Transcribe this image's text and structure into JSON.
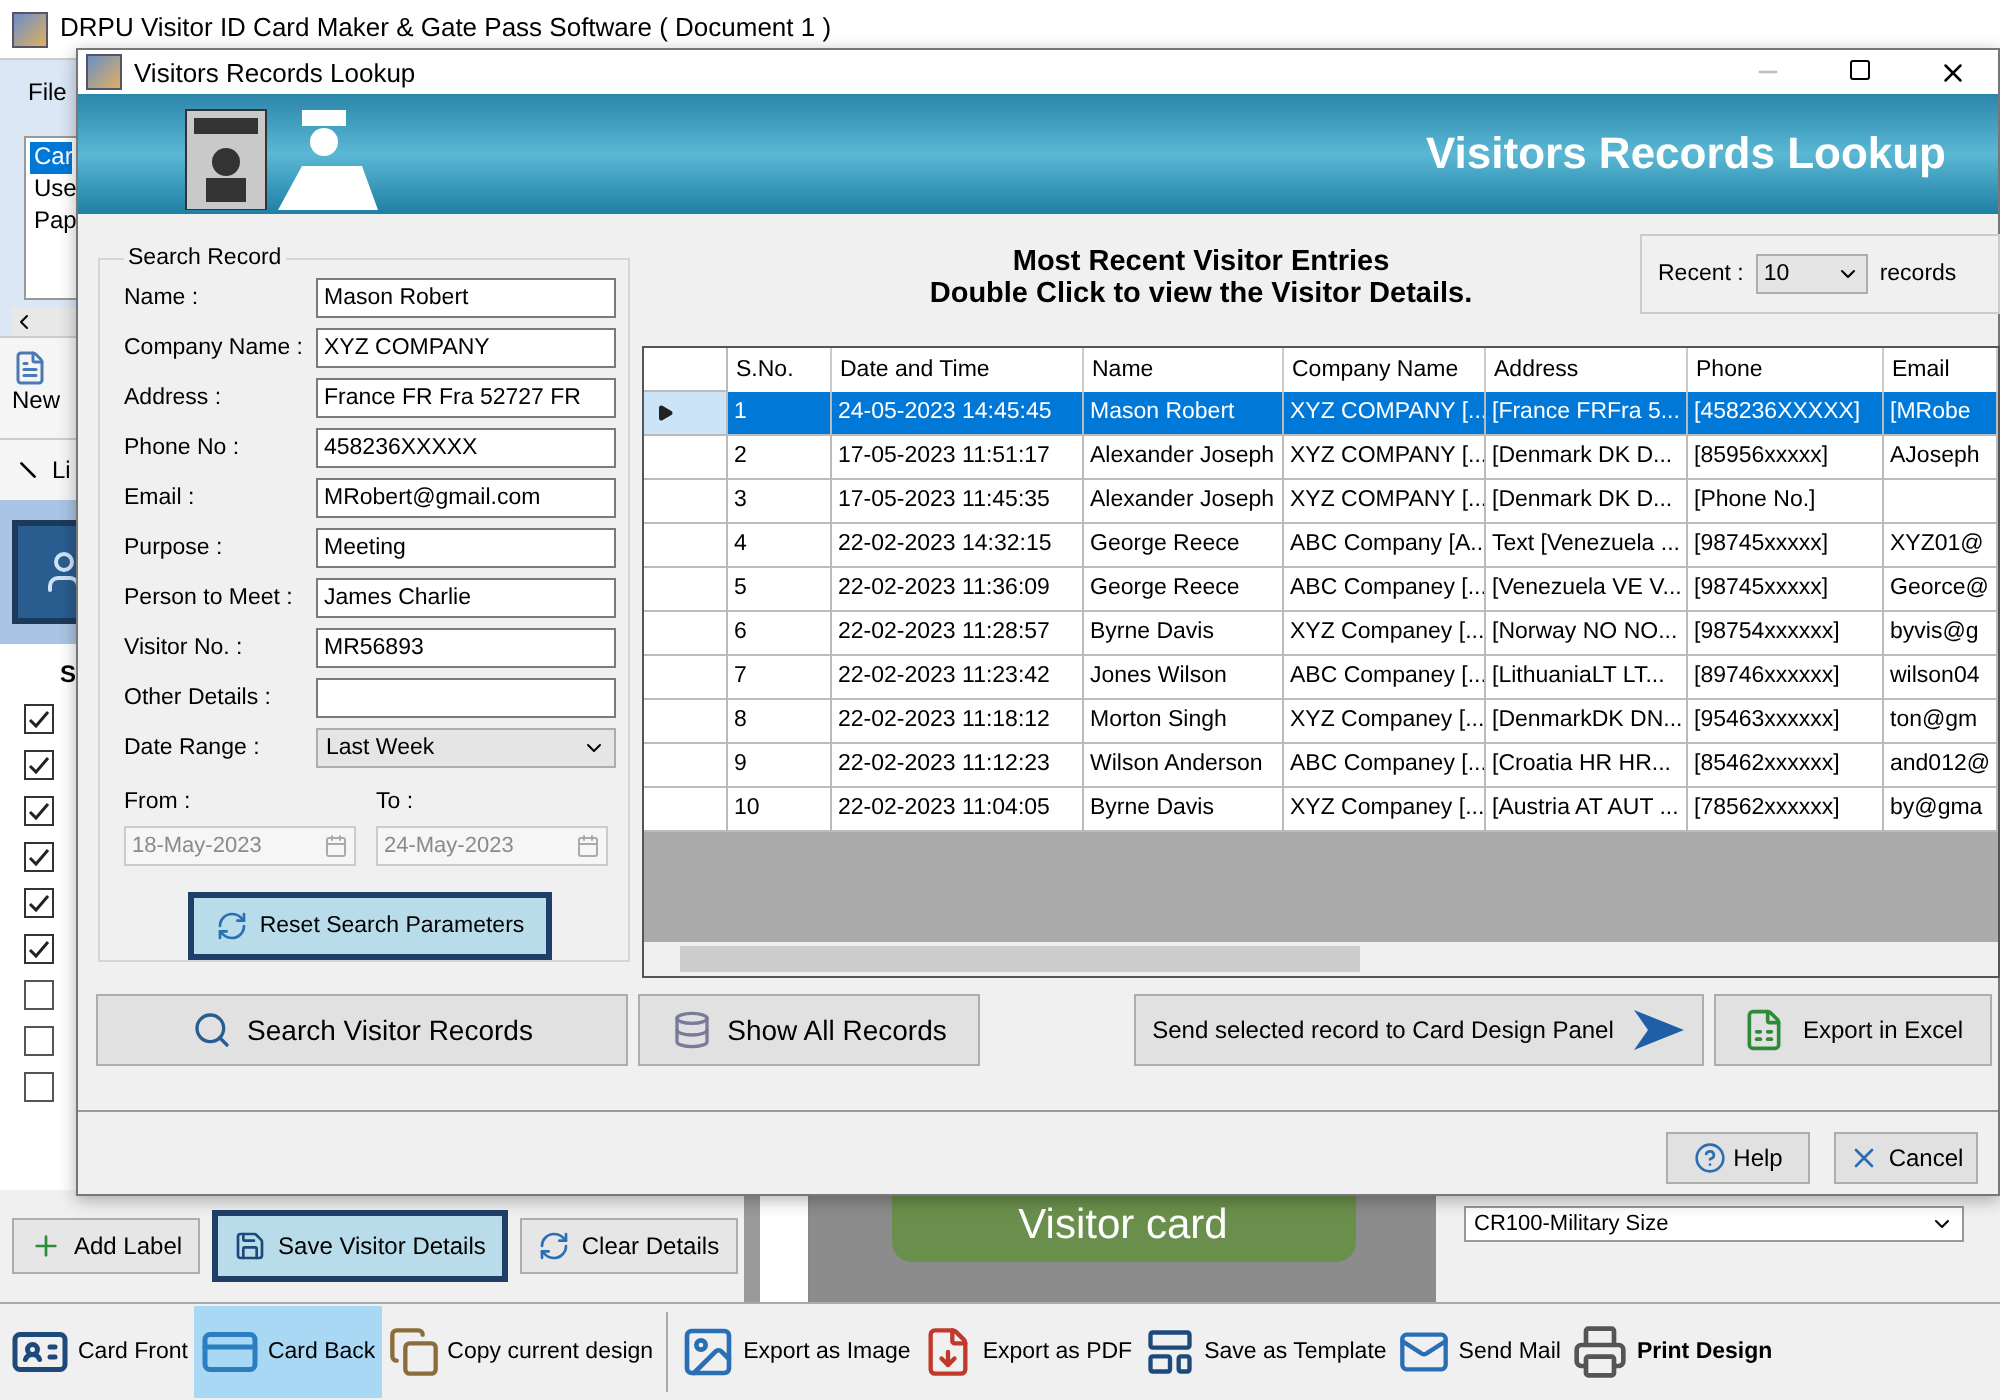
{
  "app": {
    "title": "DRPU Visitor ID Card Maker & Gate Pass Software ( Document 1 )",
    "menu": [
      "File"
    ],
    "list_items": [
      {
        "label": "Car",
        "selected": true
      },
      {
        "label": "Use",
        "selected": false
      },
      {
        "label": "Pap",
        "selected": false
      }
    ],
    "tools": [
      "New",
      "Li"
    ],
    "section_heading": "S",
    "checkboxes": [
      {
        "checked": true
      },
      {
        "checked": true
      },
      {
        "checked": true
      },
      {
        "checked": true
      },
      {
        "checked": true
      },
      {
        "checked": true
      },
      {
        "checked": false
      },
      {
        "checked": false
      },
      {
        "checked": false
      }
    ],
    "bottom_buttons": [
      {
        "label": "Add Label",
        "highlighted": false
      },
      {
        "label": "Save Visitor Details",
        "highlighted": true
      },
      {
        "label": "Clear Details",
        "highlighted": false
      }
    ],
    "canvas_text": "Visitor card",
    "size_select": "CR100-Military Size",
    "toolbar": [
      {
        "kind": "front",
        "label": "Card Front",
        "selected": false,
        "bold": false
      },
      {
        "kind": "back",
        "label": "Card Back",
        "selected": true,
        "bold": false
      },
      {
        "kind": "copy",
        "label": "Copy current design",
        "selected": false,
        "bold": false
      },
      {
        "kind": "image",
        "label": "Export as Image",
        "selected": false,
        "bold": false
      },
      {
        "kind": "pdf",
        "label": "Export as PDF",
        "selected": false,
        "bold": false
      },
      {
        "kind": "template",
        "label": "Save as Template",
        "selected": false,
        "bold": false
      },
      {
        "kind": "mail",
        "label": "Send Mail",
        "selected": false,
        "bold": false
      },
      {
        "kind": "print",
        "label": "Print Design",
        "selected": false,
        "bold": true
      }
    ]
  },
  "dialog": {
    "title": "Visitors Records Lookup",
    "banner_title": "Visitors Records Lookup",
    "search_record": {
      "legend": "Search Record",
      "fields": [
        {
          "label": "Name :",
          "value": "Mason Robert"
        },
        {
          "label": "Company Name :",
          "value": "XYZ COMPANY"
        },
        {
          "label": "Address :",
          "value": "France FR Fra 52727 FR"
        },
        {
          "label": "Phone No :",
          "value": "458236XXXXX"
        },
        {
          "label": "Email :",
          "value": "MRobert@gmail.com"
        },
        {
          "label": "Purpose :",
          "value": "Meeting"
        },
        {
          "label": "Person to Meet :",
          "value": "James Charlie"
        },
        {
          "label": "Visitor No. :",
          "value": "MR56893"
        },
        {
          "label": "Other Details :"
        }
      ],
      "date_range": {
        "label": "Date Range :",
        "value": "Last Week"
      },
      "from": {
        "label": "From :",
        "value": "18-May-2023",
        "disabled": true
      },
      "to": {
        "label": "To :",
        "value": "24-May-2023",
        "disabled": true
      },
      "reset_button": "Reset Search Parameters"
    },
    "heading": [
      "Most Recent Visitor Entries",
      "Double Click to view the Visitor Details."
    ],
    "recent": {
      "label": "Recent :",
      "value": "10",
      "unit": "records"
    },
    "table": {
      "columns": [
        "S.No.",
        "Date and Time",
        "Name",
        "Company Name",
        "Address",
        "Phone",
        "Email"
      ],
      "rows": [
        {
          "selected": true,
          "cells": [
            "1",
            "24-05-2023 14:45:45",
            "Mason Robert",
            "XYZ COMPANY [...",
            "[France FRFra 5...",
            "[458236XXXXX]",
            "[MRobe"
          ]
        },
        {
          "selected": false,
          "cells": [
            "2",
            "17-05-2023 11:51:17",
            "Alexander Joseph",
            "XYZ COMPANY [...",
            "[Denmark DK D...",
            "[85956xxxxx]",
            "AJoseph"
          ]
        },
        {
          "selected": false,
          "cells": [
            "3",
            "17-05-2023 11:45:35",
            "Alexander Joseph",
            "XYZ COMPANY [...",
            "[Denmark DK D...",
            "[Phone No.]"
          ]
        },
        {
          "selected": false,
          "cells": [
            "4",
            "22-02-2023 14:32:15",
            "George Reece",
            "ABC Company [A...",
            "Text [Venezuela ...",
            "[98745xxxxx]",
            "XYZ01@"
          ]
        },
        {
          "selected": false,
          "cells": [
            "5",
            "22-02-2023 11:36:09",
            "George Reece",
            "ABC Companey [...",
            "[Venezuela VE V...",
            "[98745xxxxx]",
            "Georce@"
          ]
        },
        {
          "selected": false,
          "cells": [
            "6",
            "22-02-2023 11:28:57",
            "Byrne Davis",
            "XYZ Companey [...",
            "[Norway NO NO...",
            "[98754xxxxxx]",
            "byvis@g"
          ]
        },
        {
          "selected": false,
          "cells": [
            "7",
            "22-02-2023 11:23:42",
            "Jones Wilson",
            "ABC Companey [...",
            "[LithuaniaLT LT...",
            "[89746xxxxxx]",
            "wilson04"
          ]
        },
        {
          "selected": false,
          "cells": [
            "8",
            "22-02-2023 11:18:12",
            "Morton Singh",
            "XYZ Companey [...",
            "[DenmarkDK DN...",
            "[95463xxxxxx]",
            "ton@gm"
          ]
        },
        {
          "selected": false,
          "cells": [
            "9",
            "22-02-2023 11:12:23",
            "Wilson Anderson",
            "ABC Companey [...",
            "[Croatia HR HR...",
            "[85462xxxxxx]",
            "and012@"
          ]
        },
        {
          "selected": false,
          "cells": [
            "10",
            "22-02-2023 11:04:05",
            "Byrne Davis",
            "XYZ Companey [...",
            "[Austria AT AUT ...",
            "[78562xxxxxx]",
            "by@gma"
          ]
        }
      ]
    },
    "actions": [
      {
        "kind": "search",
        "label": "Search Visitor Records"
      },
      {
        "kind": "all",
        "label": "Show All Records"
      },
      {
        "kind": "send",
        "label": "Send selected record to Card Design Panel"
      },
      {
        "kind": "excel",
        "label": "Export in Excel"
      }
    ],
    "footer_buttons": [
      {
        "kind": "help",
        "label": "Help"
      },
      {
        "kind": "cancel",
        "label": "Cancel"
      }
    ]
  }
}
